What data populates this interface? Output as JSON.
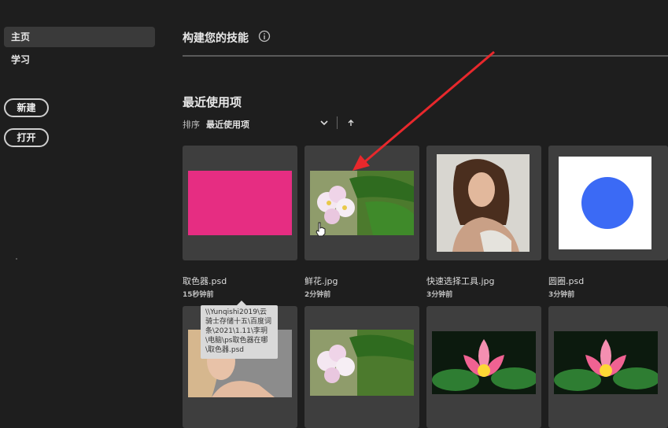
{
  "sidebar": {
    "items": [
      {
        "label": "主页"
      },
      {
        "label": "学习"
      }
    ],
    "new_label": "新建",
    "open_label": "打开"
  },
  "header": {
    "title": "构建您的技能"
  },
  "recent": {
    "title": "最近使用项",
    "sort_label": "排序",
    "sort_value": "最近使用项"
  },
  "files": [
    {
      "name": "取色器.psd",
      "time": "15秒钟前"
    },
    {
      "name": "鲜花.jpg",
      "time": "2分钟前"
    },
    {
      "name": "快速选择工具.jpg",
      "time": "3分钟前"
    },
    {
      "name": "圆圈.psd",
      "time": "3分钟前"
    }
  ],
  "tooltip": {
    "text": "\\\\Yunqishi2019\\云骑士存储十五\\百度词条\\2021\\1.11\\李玥\\电脑\\ps取色器在哪\\取色器.psd"
  },
  "colors": {
    "accent": "#e62d82",
    "circle": "#3b6af5",
    "arrow": "#e8282c"
  }
}
